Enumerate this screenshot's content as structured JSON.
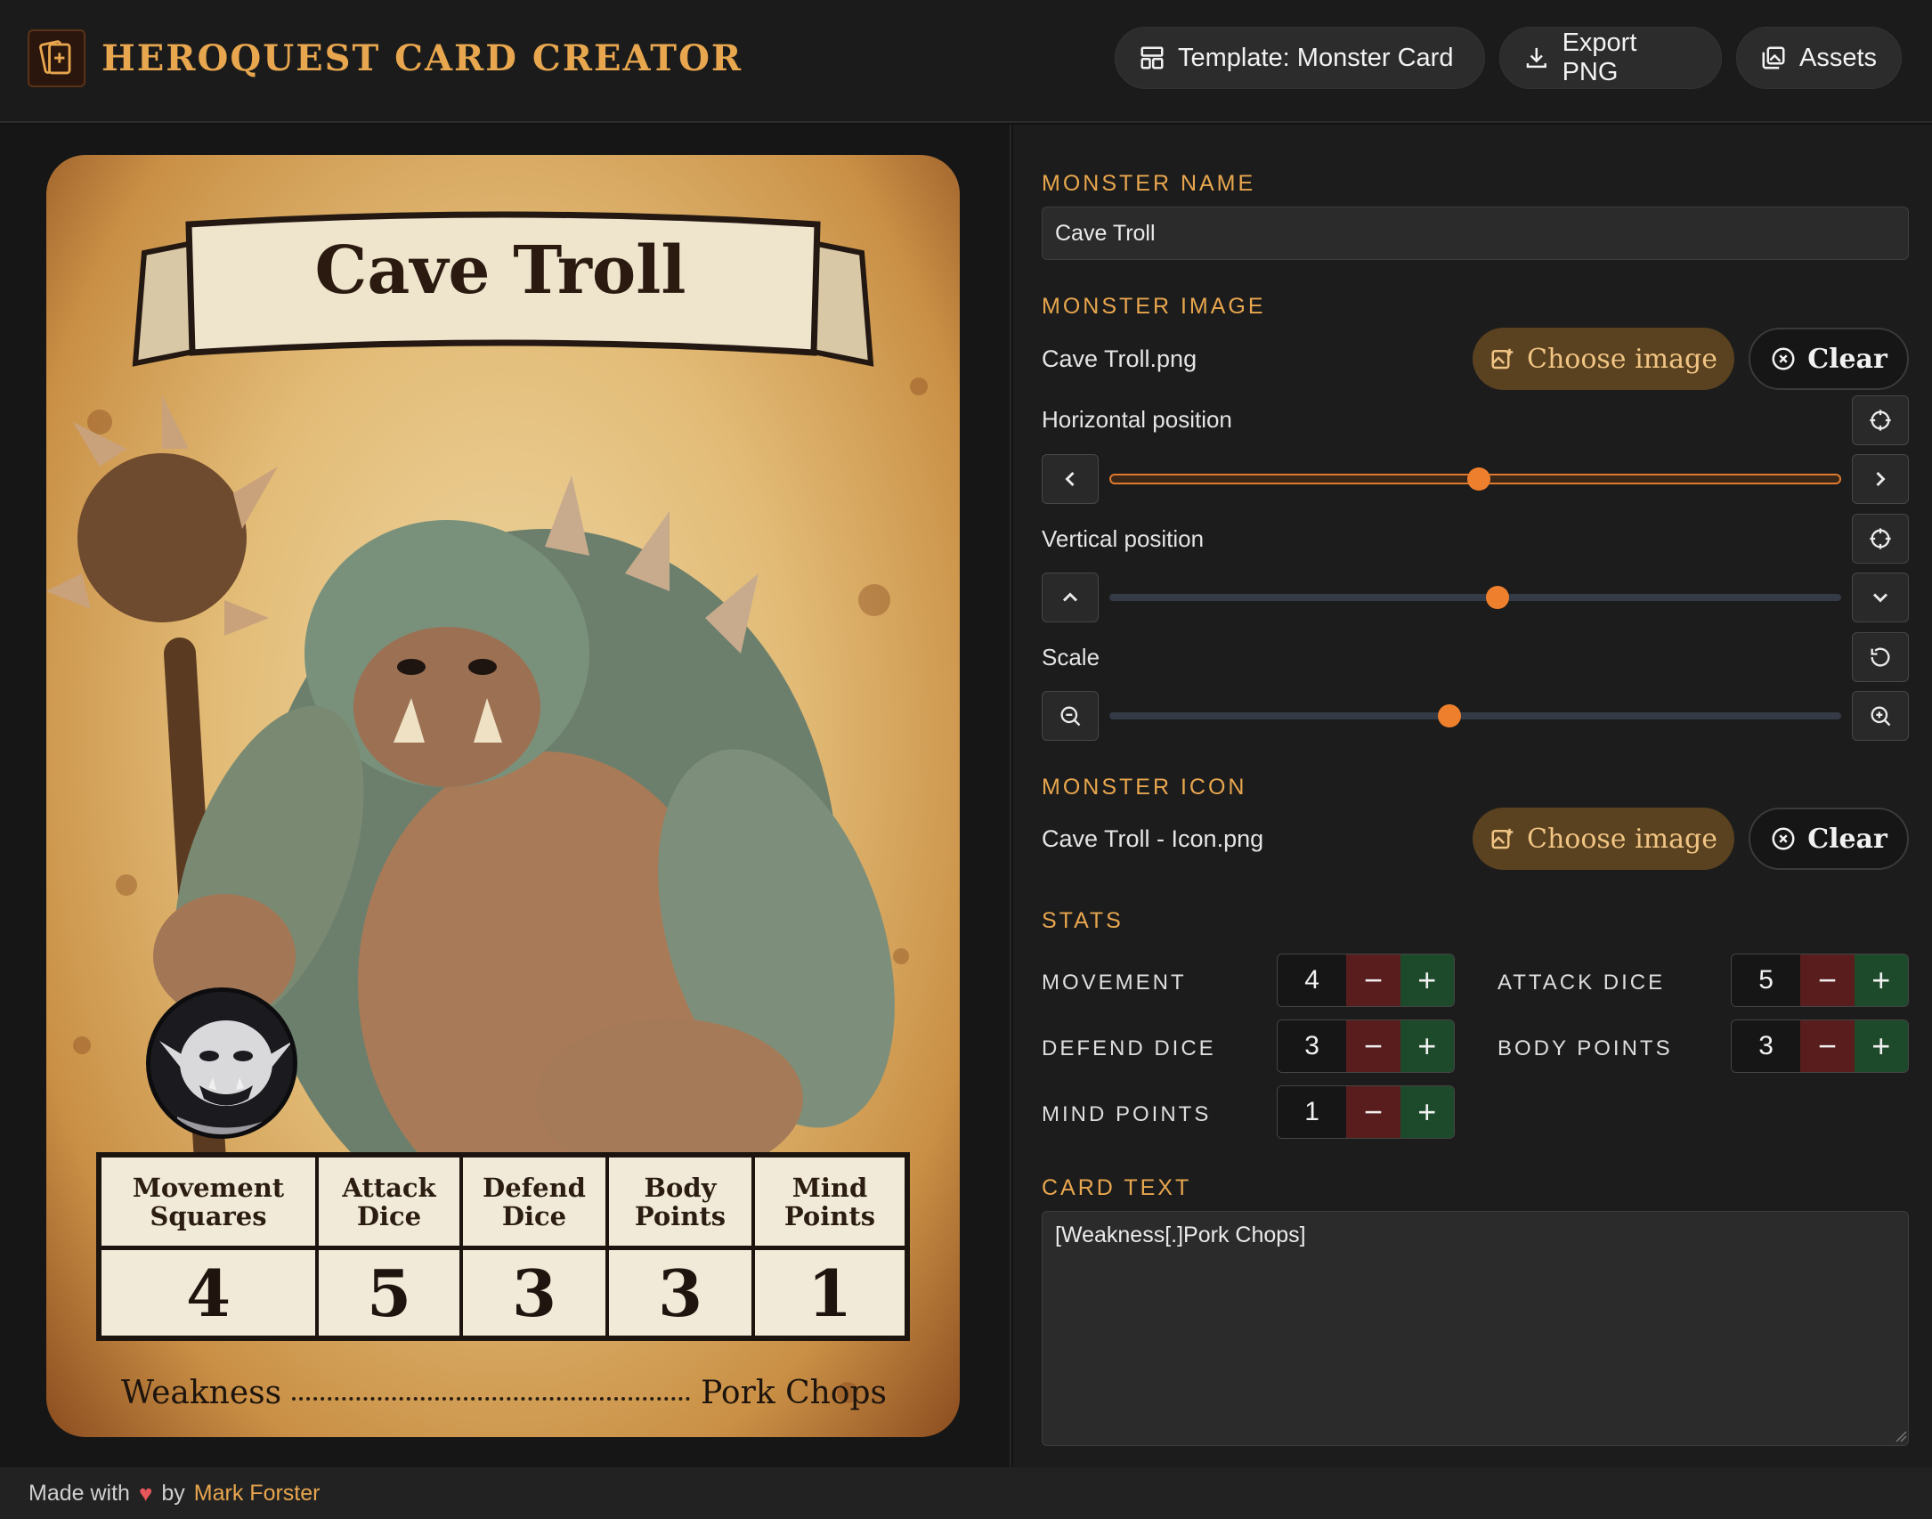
{
  "header": {
    "title": "HeroQuest Card Creator",
    "template_label": "Template: Monster Card",
    "export_label": "Export PNG",
    "assets_label": "Assets"
  },
  "card": {
    "name": "Cave Troll",
    "stat_headers": [
      [
        "Movement",
        "Squares"
      ],
      [
        "Attack",
        "Dice"
      ],
      [
        "Defend",
        "Dice"
      ],
      [
        "Body",
        "Points"
      ],
      [
        "Mind",
        "Points"
      ]
    ],
    "stat_values": [
      "4",
      "5",
      "3",
      "3",
      "1"
    ],
    "text_left": "Weakness",
    "text_right": "Pork Chops"
  },
  "editor": {
    "monster_name": {
      "label": "Monster Name",
      "value": "Cave Troll"
    },
    "monster_image": {
      "label": "Monster Image",
      "file": "Cave Troll.png",
      "choose_label": "Choose image",
      "clear_label": "Clear",
      "horizontal_label": "Horizontal position",
      "horizontal_value": 0.505,
      "vertical_label": "Vertical position",
      "vertical_value": 0.53,
      "scale_label": "Scale",
      "scale_value": 0.465
    },
    "monster_icon": {
      "label": "Monster Icon",
      "file": "Cave Troll - Icon.png",
      "choose_label": "Choose image",
      "clear_label": "Clear"
    },
    "stats": {
      "label": "Stats",
      "movement": {
        "label": "Movement",
        "value": "4"
      },
      "attack": {
        "label": "Attack Dice",
        "value": "5"
      },
      "defend": {
        "label": "Defend Dice",
        "value": "3"
      },
      "body": {
        "label": "Body Points",
        "value": "3"
      },
      "mind": {
        "label": "Mind Points",
        "value": "1"
      },
      "minus": "−",
      "plus": "+"
    },
    "card_text": {
      "label": "Card Text",
      "value": "[Weakness[.]Pork Chops]"
    }
  },
  "footer": {
    "made_with": "Made with",
    "heart": "♥",
    "by": "by",
    "author": "Mark Forster"
  },
  "colors": {
    "accent": "#e8a64e",
    "slider_thumb": "#ee7f2d",
    "minus_bg": "#5a1d1d",
    "plus_bg": "#1d4a2a"
  }
}
